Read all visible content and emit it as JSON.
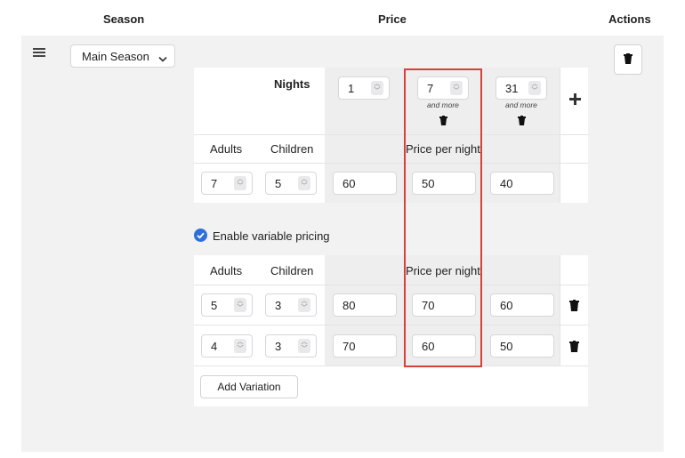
{
  "headers": {
    "season": "Season",
    "price": "Price",
    "actions": "Actions"
  },
  "season": {
    "selected": "Main Season"
  },
  "nights": {
    "label": "Nights",
    "columns": [
      {
        "value": "1",
        "sub": ""
      },
      {
        "value": "7",
        "sub": "and more"
      },
      {
        "value": "31",
        "sub": "and more"
      }
    ]
  },
  "base_table": {
    "col_adults": "Adults",
    "col_children": "Children",
    "price_header": "Price per night",
    "row": {
      "adults": "7",
      "children": "5",
      "prices": [
        "60",
        "50",
        "40"
      ]
    }
  },
  "variable": {
    "checkbox_label": "Enable variable pricing",
    "checked": true,
    "col_adults": "Adults",
    "col_children": "Children",
    "price_header": "Price per night",
    "rows": [
      {
        "adults": "5",
        "children": "3",
        "prices": [
          "80",
          "70",
          "60"
        ]
      },
      {
        "adults": "4",
        "children": "3",
        "prices": [
          "70",
          "60",
          "50"
        ]
      }
    ],
    "add_label": "Add Variation"
  },
  "colors": {
    "highlight": "#d9403a",
    "checkbox": "#2f6fdb"
  },
  "icons": [
    "hamburger-icon",
    "chevron-down-icon",
    "trash-icon",
    "plus-icon",
    "check-icon",
    "spinner-icon"
  ]
}
